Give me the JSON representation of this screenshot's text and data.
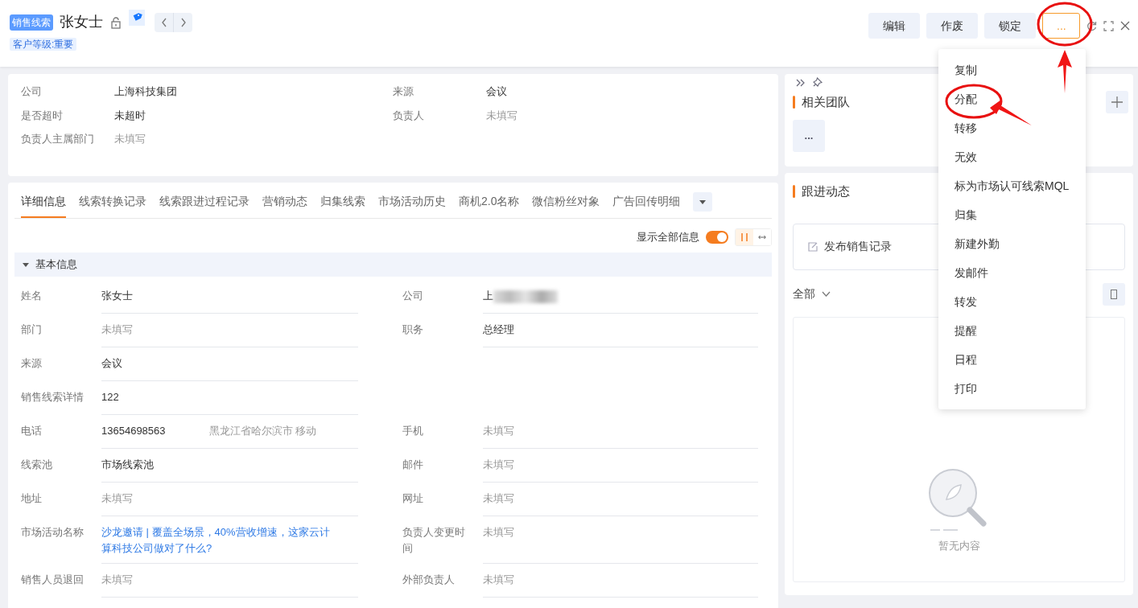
{
  "header": {
    "badge": "销售线索",
    "title": "张女士",
    "locked": false,
    "tag": "客户等级:重要"
  },
  "actions": [
    {
      "label": "编辑",
      "kind": "plain"
    },
    {
      "label": "作废",
      "kind": "plain"
    },
    {
      "label": "锁定",
      "kind": "plain"
    },
    {
      "label": "...",
      "kind": "more"
    }
  ],
  "summary": [
    {
      "label": "公司",
      "value": "上海科技集团",
      "muted": false
    },
    {
      "label": "来源",
      "value": "会议",
      "muted": false
    },
    {
      "label": "是否超时",
      "value": "未超时",
      "muted": false
    },
    {
      "label": "负责人",
      "value": "未填写",
      "muted": true
    },
    {
      "label": "负责人主属部门",
      "value": "未填写",
      "muted": true
    }
  ],
  "tabs": [
    {
      "label": "详细信息",
      "selected": true
    },
    {
      "label": "线索转换记录",
      "selected": false
    },
    {
      "label": "线索跟进过程记录",
      "selected": false
    },
    {
      "label": "营销动态",
      "selected": false
    },
    {
      "label": "归集线索",
      "selected": false
    },
    {
      "label": "市场活动历史",
      "selected": false
    },
    {
      "label": "商机2.0名称",
      "selected": false
    },
    {
      "label": "微信粉丝对象",
      "selected": false
    },
    {
      "label": "广告回传明细",
      "selected": false
    }
  ],
  "show_all": {
    "label": "显示全部信息",
    "on": true
  },
  "section": {
    "title": "基本信息",
    "expanded": true
  },
  "rows": [
    {
      "cells": [
        {
          "label": "姓名",
          "value": "张女士",
          "kind": "text",
          "muted": false
        },
        {
          "label": "公司",
          "value": "上",
          "kind": "redacted",
          "muted": false
        }
      ]
    },
    {
      "cells": [
        {
          "label": "部门",
          "value": "未填写",
          "kind": "text",
          "muted": true
        },
        {
          "label": "职务",
          "value": "总经理",
          "kind": "text",
          "muted": false
        }
      ]
    },
    {
      "cells": [
        {
          "label": "来源",
          "value": "会议",
          "kind": "text",
          "muted": false
        }
      ]
    },
    {
      "cells": [
        {
          "label": "销售线索详情",
          "value": "122",
          "kind": "text",
          "muted": false
        }
      ]
    },
    {
      "cells": [
        {
          "label": "电话",
          "value": "13654698563",
          "note": "黑龙江省哈尔滨市 移动",
          "kind": "text",
          "muted": false
        },
        {
          "label": "手机",
          "value": "未填写",
          "kind": "text",
          "muted": true
        }
      ]
    },
    {
      "cells": [
        {
          "label": "线索池",
          "value": "市场线索池",
          "kind": "text",
          "muted": false
        },
        {
          "label": "邮件",
          "value": "未填写",
          "kind": "text",
          "muted": true
        }
      ]
    },
    {
      "cells": [
        {
          "label": "地址",
          "value": "未填写",
          "kind": "text",
          "muted": true
        },
        {
          "label": "网址",
          "value": "未填写",
          "kind": "text",
          "muted": true
        }
      ]
    },
    {
      "cells": [
        {
          "label": "市场活动名称",
          "value": "沙龙邀请 | 覆盖全场景，40%营收增速，这家云计算科技公司做对了什么?",
          "kind": "link"
        },
        {
          "label": "负责人变更时间",
          "value": "未填写",
          "kind": "text",
          "muted": true
        }
      ]
    },
    {
      "cells": [
        {
          "label": "销售人员退回",
          "value": "未填写",
          "kind": "text",
          "muted": true
        },
        {
          "label": "外部负责人",
          "value": "未填写",
          "kind": "text",
          "muted": true
        }
      ]
    }
  ],
  "team": {
    "title": "相关团队",
    "more": "..."
  },
  "followup": {
    "title": "跟进动态",
    "publish": "发布销售记录",
    "filter": "全部",
    "empty": "暂无内容"
  },
  "menu": [
    {
      "label": "复制"
    },
    {
      "label": "分配"
    },
    {
      "label": "转移"
    },
    {
      "label": "无效"
    },
    {
      "label": "标为市场认可线索MQL"
    },
    {
      "label": "归集"
    },
    {
      "label": "新建外勤"
    },
    {
      "label": "发邮件"
    },
    {
      "label": "转发"
    },
    {
      "label": "提醒"
    },
    {
      "label": "日程"
    },
    {
      "label": "打印"
    }
  ],
  "annotations": [
    {
      "kind": "circle"
    },
    {
      "kind": "arrow"
    },
    {
      "kind": "circle"
    },
    {
      "kind": "arrow"
    }
  ]
}
